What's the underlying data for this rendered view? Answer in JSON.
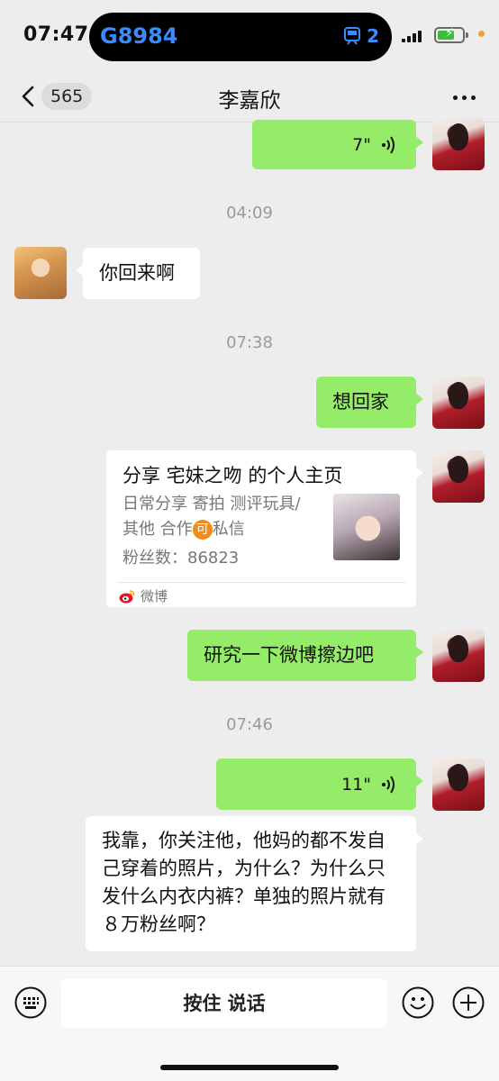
{
  "status_bar": {
    "time": "07:47",
    "train_code": "G8984",
    "island_count": "2"
  },
  "nav": {
    "unread_count": "565",
    "title": "李嘉欣"
  },
  "messages": {
    "voice_1_duration": "7\"",
    "time_1": "04:09",
    "friend_text_1": "你回来啊",
    "time_2": "07:38",
    "self_text_1": "想回家",
    "card": {
      "title": "分享 宅妹之吻 的个人主页",
      "desc_line_1": "日常分享 寄拍 测评玩具/",
      "desc_line_2_prefix": "其他 合作",
      "desc_line_2_badge": "可",
      "desc_line_2_suffix": "私信",
      "fans": "粉丝数：86823",
      "source": "微博"
    },
    "self_text_2": "研究一下微博擦边吧",
    "time_3": "07:46",
    "voice_2_duration": "11\"",
    "self_text_3": "我靠，你关注他，他妈的都不发自己穿着的照片，为什么？为什么只发什么内衣内裤？单独的照片就有８万粉丝啊？"
  },
  "input_bar": {
    "hold_to_talk": "按住 说话"
  },
  "colors": {
    "self_bubble": "#95ec69",
    "background": "#ededed",
    "island_text": "#3b8bff"
  },
  "icons": [
    "back-icon",
    "more-icon",
    "voice-icon",
    "weibo-icon",
    "keyboard-icon",
    "emoji-icon",
    "plus-icon",
    "signal-icon",
    "battery-icon",
    "train-icon"
  ]
}
